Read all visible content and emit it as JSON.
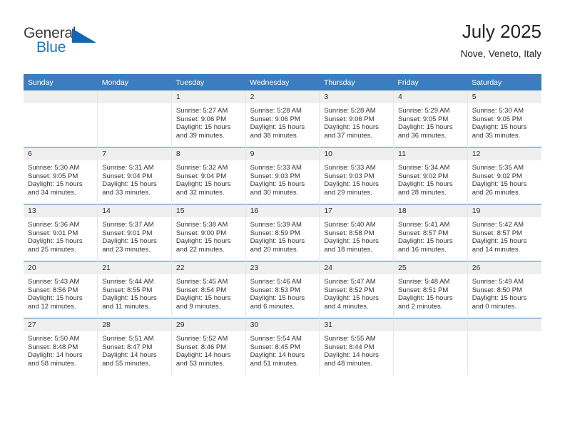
{
  "brand": {
    "name_top": "General",
    "name_bottom": "Blue",
    "logo_icon": "triangle-logo-icon",
    "color_primary": "#1a75c4",
    "color_text": "#3b3b3b"
  },
  "header": {
    "title": "July 2025",
    "subtitle": "Nove, Veneto, Italy"
  },
  "theme": {
    "header_bar": "#3b7dbe",
    "daynum_band": "#efefef",
    "text": "#333333"
  },
  "calendar": {
    "weekday_headers": [
      "Sunday",
      "Monday",
      "Tuesday",
      "Wednesday",
      "Thursday",
      "Friday",
      "Saturday"
    ],
    "weeks": [
      [
        {
          "day": "",
          "lines": []
        },
        {
          "day": "",
          "lines": []
        },
        {
          "day": "1",
          "lines": [
            "Sunrise: 5:27 AM",
            "Sunset: 9:06 PM",
            "Daylight: 15 hours",
            "and 39 minutes."
          ]
        },
        {
          "day": "2",
          "lines": [
            "Sunrise: 5:28 AM",
            "Sunset: 9:06 PM",
            "Daylight: 15 hours",
            "and 38 minutes."
          ]
        },
        {
          "day": "3",
          "lines": [
            "Sunrise: 5:28 AM",
            "Sunset: 9:06 PM",
            "Daylight: 15 hours",
            "and 37 minutes."
          ]
        },
        {
          "day": "4",
          "lines": [
            "Sunrise: 5:29 AM",
            "Sunset: 9:05 PM",
            "Daylight: 15 hours",
            "and 36 minutes."
          ]
        },
        {
          "day": "5",
          "lines": [
            "Sunrise: 5:30 AM",
            "Sunset: 9:05 PM",
            "Daylight: 15 hours",
            "and 35 minutes."
          ]
        }
      ],
      [
        {
          "day": "6",
          "lines": [
            "Sunrise: 5:30 AM",
            "Sunset: 9:05 PM",
            "Daylight: 15 hours",
            "and 34 minutes."
          ]
        },
        {
          "day": "7",
          "lines": [
            "Sunrise: 5:31 AM",
            "Sunset: 9:04 PM",
            "Daylight: 15 hours",
            "and 33 minutes."
          ]
        },
        {
          "day": "8",
          "lines": [
            "Sunrise: 5:32 AM",
            "Sunset: 9:04 PM",
            "Daylight: 15 hours",
            "and 32 minutes."
          ]
        },
        {
          "day": "9",
          "lines": [
            "Sunrise: 5:33 AM",
            "Sunset: 9:03 PM",
            "Daylight: 15 hours",
            "and 30 minutes."
          ]
        },
        {
          "day": "10",
          "lines": [
            "Sunrise: 5:33 AM",
            "Sunset: 9:03 PM",
            "Daylight: 15 hours",
            "and 29 minutes."
          ]
        },
        {
          "day": "11",
          "lines": [
            "Sunrise: 5:34 AM",
            "Sunset: 9:02 PM",
            "Daylight: 15 hours",
            "and 28 minutes."
          ]
        },
        {
          "day": "12",
          "lines": [
            "Sunrise: 5:35 AM",
            "Sunset: 9:02 PM",
            "Daylight: 15 hours",
            "and 26 minutes."
          ]
        }
      ],
      [
        {
          "day": "13",
          "lines": [
            "Sunrise: 5:36 AM",
            "Sunset: 9:01 PM",
            "Daylight: 15 hours",
            "and 25 minutes."
          ]
        },
        {
          "day": "14",
          "lines": [
            "Sunrise: 5:37 AM",
            "Sunset: 9:01 PM",
            "Daylight: 15 hours",
            "and 23 minutes."
          ]
        },
        {
          "day": "15",
          "lines": [
            "Sunrise: 5:38 AM",
            "Sunset: 9:00 PM",
            "Daylight: 15 hours",
            "and 22 minutes."
          ]
        },
        {
          "day": "16",
          "lines": [
            "Sunrise: 5:39 AM",
            "Sunset: 8:59 PM",
            "Daylight: 15 hours",
            "and 20 minutes."
          ]
        },
        {
          "day": "17",
          "lines": [
            "Sunrise: 5:40 AM",
            "Sunset: 8:58 PM",
            "Daylight: 15 hours",
            "and 18 minutes."
          ]
        },
        {
          "day": "18",
          "lines": [
            "Sunrise: 5:41 AM",
            "Sunset: 8:57 PM",
            "Daylight: 15 hours",
            "and 16 minutes."
          ]
        },
        {
          "day": "19",
          "lines": [
            "Sunrise: 5:42 AM",
            "Sunset: 8:57 PM",
            "Daylight: 15 hours",
            "and 14 minutes."
          ]
        }
      ],
      [
        {
          "day": "20",
          "lines": [
            "Sunrise: 5:43 AM",
            "Sunset: 8:56 PM",
            "Daylight: 15 hours",
            "and 12 minutes."
          ]
        },
        {
          "day": "21",
          "lines": [
            "Sunrise: 5:44 AM",
            "Sunset: 8:55 PM",
            "Daylight: 15 hours",
            "and 11 minutes."
          ]
        },
        {
          "day": "22",
          "lines": [
            "Sunrise: 5:45 AM",
            "Sunset: 8:54 PM",
            "Daylight: 15 hours",
            "and 9 minutes."
          ]
        },
        {
          "day": "23",
          "lines": [
            "Sunrise: 5:46 AM",
            "Sunset: 8:53 PM",
            "Daylight: 15 hours",
            "and 6 minutes."
          ]
        },
        {
          "day": "24",
          "lines": [
            "Sunrise: 5:47 AM",
            "Sunset: 8:52 PM",
            "Daylight: 15 hours",
            "and 4 minutes."
          ]
        },
        {
          "day": "25",
          "lines": [
            "Sunrise: 5:48 AM",
            "Sunset: 8:51 PM",
            "Daylight: 15 hours",
            "and 2 minutes."
          ]
        },
        {
          "day": "26",
          "lines": [
            "Sunrise: 5:49 AM",
            "Sunset: 8:50 PM",
            "Daylight: 15 hours",
            "and 0 minutes."
          ]
        }
      ],
      [
        {
          "day": "27",
          "lines": [
            "Sunrise: 5:50 AM",
            "Sunset: 8:48 PM",
            "Daylight: 14 hours",
            "and 58 minutes."
          ]
        },
        {
          "day": "28",
          "lines": [
            "Sunrise: 5:51 AM",
            "Sunset: 8:47 PM",
            "Daylight: 14 hours",
            "and 55 minutes."
          ]
        },
        {
          "day": "29",
          "lines": [
            "Sunrise: 5:52 AM",
            "Sunset: 8:46 PM",
            "Daylight: 14 hours",
            "and 53 minutes."
          ]
        },
        {
          "day": "30",
          "lines": [
            "Sunrise: 5:54 AM",
            "Sunset: 8:45 PM",
            "Daylight: 14 hours",
            "and 51 minutes."
          ]
        },
        {
          "day": "31",
          "lines": [
            "Sunrise: 5:55 AM",
            "Sunset: 8:44 PM",
            "Daylight: 14 hours",
            "and 48 minutes."
          ]
        },
        {
          "day": "",
          "lines": []
        },
        {
          "day": "",
          "lines": []
        }
      ]
    ]
  }
}
